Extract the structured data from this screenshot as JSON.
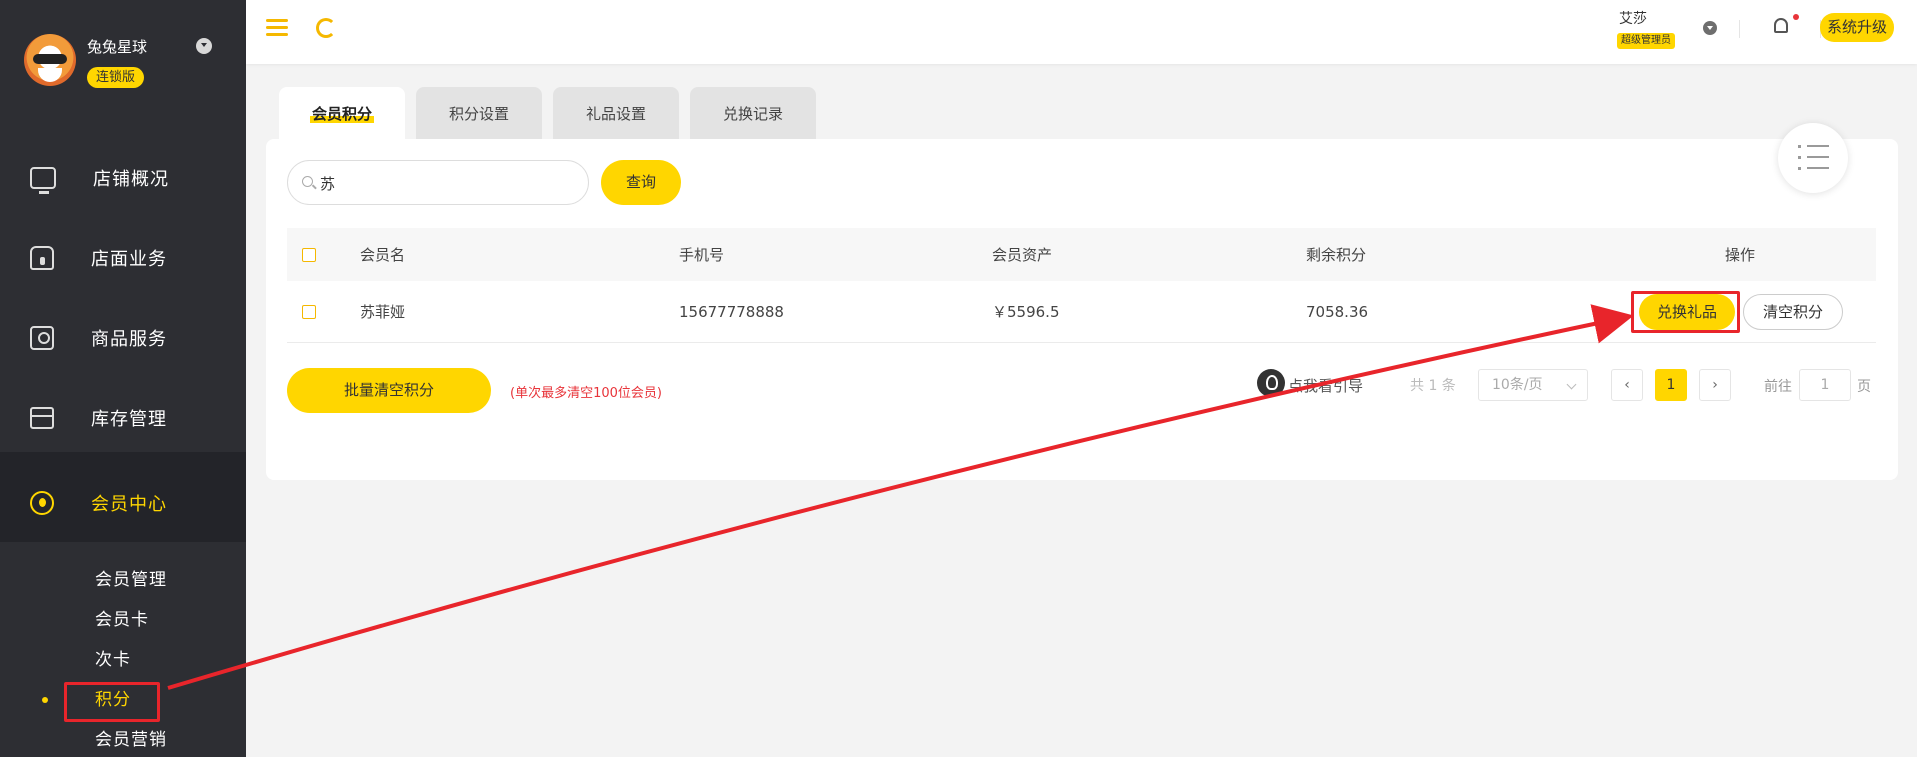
{
  "profile": {
    "store_name": "兔兔星球",
    "edition": "连锁版"
  },
  "nav": {
    "items": [
      {
        "label": "店铺概况",
        "icon": "monitor-icon"
      },
      {
        "label": "店面业务",
        "icon": "store-icon"
      },
      {
        "label": "商品服务",
        "icon": "bag-icon"
      },
      {
        "label": "库存管理",
        "icon": "box-icon"
      },
      {
        "label": "会员中心",
        "icon": "member-icon"
      }
    ],
    "sub_items": [
      {
        "label": "会员管理"
      },
      {
        "label": "会员卡"
      },
      {
        "label": "次卡"
      },
      {
        "label": "积分"
      },
      {
        "label": "会员营销"
      }
    ]
  },
  "header": {
    "user_name": "艾莎",
    "user_role": "超级管理员",
    "upgrade_label": "系统升级"
  },
  "tabs": [
    {
      "label": "会员积分"
    },
    {
      "label": "积分设置"
    },
    {
      "label": "礼品设置"
    },
    {
      "label": "兑换记录"
    }
  ],
  "search": {
    "value": "苏",
    "query_label": "查询"
  },
  "table": {
    "columns": [
      "会员名",
      "手机号",
      "会员资产",
      "剩余积分",
      "操作"
    ],
    "rows": [
      {
        "name": "苏菲娅",
        "phone": "15677778888",
        "assets": "￥5596.5",
        "points": "7058.36",
        "action_exchange": "兑换礼品",
        "action_clear": "清空积分"
      }
    ]
  },
  "footer": {
    "batch_clear_label": "批量清空积分",
    "batch_note": "(单次最多清空100位会员)",
    "guide_label": "点我看引导",
    "total": "共 1 条",
    "page_size": "10条/页",
    "current_page": "1",
    "goto_label": "前往",
    "goto_value": "1",
    "goto_suffix": "页"
  },
  "colors": {
    "accent": "#ffd600",
    "sidebar": "#2d2e33",
    "annotation": "#e8252b"
  }
}
